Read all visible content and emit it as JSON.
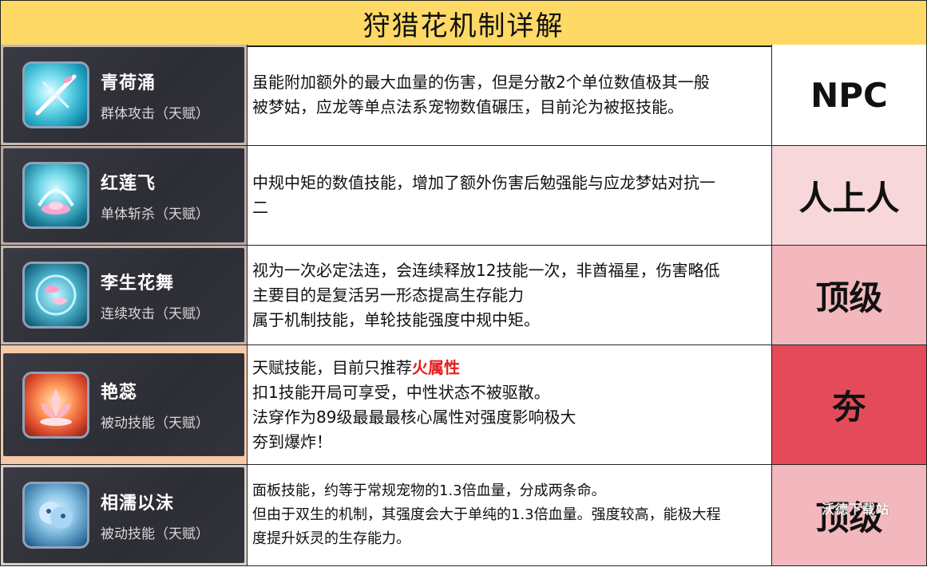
{
  "title": "狩猎花机制详解",
  "watermark": "沃德下载站",
  "rows": [
    {
      "skill_name": "青荷涌",
      "skill_type": "群体攻击（天赋）",
      "icon": "water-slash-icon",
      "lines": [
        "虽能附加额外的最大血量的伤害，但是分散2个单位数值极其一般",
        "被梦姑，应龙等单点法系宠物数值碾压，目前沦为被抠技能。"
      ],
      "rating": "NPC",
      "rating_color": "#ffffff"
    },
    {
      "skill_name": "红莲飞",
      "skill_type": "单体斩杀（天赋）",
      "icon": "lotus-water-icon",
      "lines": [
        "中规中矩的数值技能，增加了额外伤害后勉强能与应龙梦姑对抗一",
        "二"
      ],
      "rating": "人上人",
      "rating_color": "#f8d7da"
    },
    {
      "skill_name": "李生花舞",
      "skill_type": "连续攻击（天赋）",
      "icon": "twin-fish-icon",
      "lines": [
        "视为一次必定法连，会连续释放12技能一次，非酋福星，伤害略低",
        "主要目的是复活另一形态提高生存能力",
        "属于机制技能，单轮技能强度中规中矩。"
      ],
      "rating": "顶级",
      "rating_color": "#f2b8bd"
    },
    {
      "skill_name": "艳蕊",
      "skill_type": "被动技能（天赋）",
      "icon": "fire-lotus-icon",
      "line1_prefix": "天赋技能，目前只推荐",
      "line1_highlight": "火属性",
      "lines": [
        "扣1技能开局可享受，中性状态不被驱散。",
        "法穿作为89级最最最核心属性对强度影响极大",
        "夯到爆炸！"
      ],
      "rating": "夯",
      "rating_color": "#e34b5b"
    },
    {
      "skill_name": "相濡以沫",
      "skill_type": "被动技能（天赋）",
      "icon": "twin-spirit-icon",
      "lines": [
        "面板技能，约等于常规宠物的1.3倍血量，分成两条命。",
        "但由于双生的机制，其强度会大于单纯的1.3倍血量。强度较高，能极大程",
        "度提升妖灵的生存能力。"
      ],
      "rating": "顶级",
      "rating_color": "#f2b8bd"
    }
  ]
}
